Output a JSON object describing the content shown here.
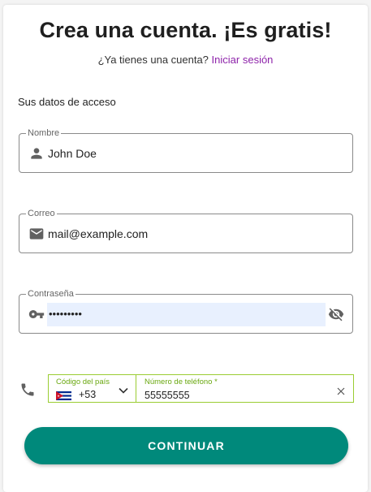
{
  "header": {
    "title": "Crea una cuenta. ¡Es gratis!",
    "subtitle_text": "¿Ya tienes una cuenta?",
    "login_link": "Iniciar sesión"
  },
  "section": {
    "access_label": "Sus datos de acceso"
  },
  "fields": {
    "name": {
      "label": "Nombre",
      "value": "John Doe",
      "icon": "person-icon"
    },
    "email": {
      "label": "Correo",
      "value": "mail@example.com",
      "icon": "mail-icon"
    },
    "password": {
      "label": "Contraseña",
      "masked_value": "•••••••••",
      "icon": "key-icon",
      "toggle_icon": "eye-off-icon"
    }
  },
  "phone": {
    "icon": "phone-icon",
    "country_label": "Código del país",
    "country_code": "+53",
    "country_flag": "cuba-flag",
    "number_label": "Número de teléfono *",
    "number_value": "55555555"
  },
  "actions": {
    "continue_label": "CONTINUAR"
  },
  "colors": {
    "accent": "#00897b",
    "link": "#8e24aa",
    "phone_border": "#9acd32",
    "autofill": "#e8f0fe"
  }
}
